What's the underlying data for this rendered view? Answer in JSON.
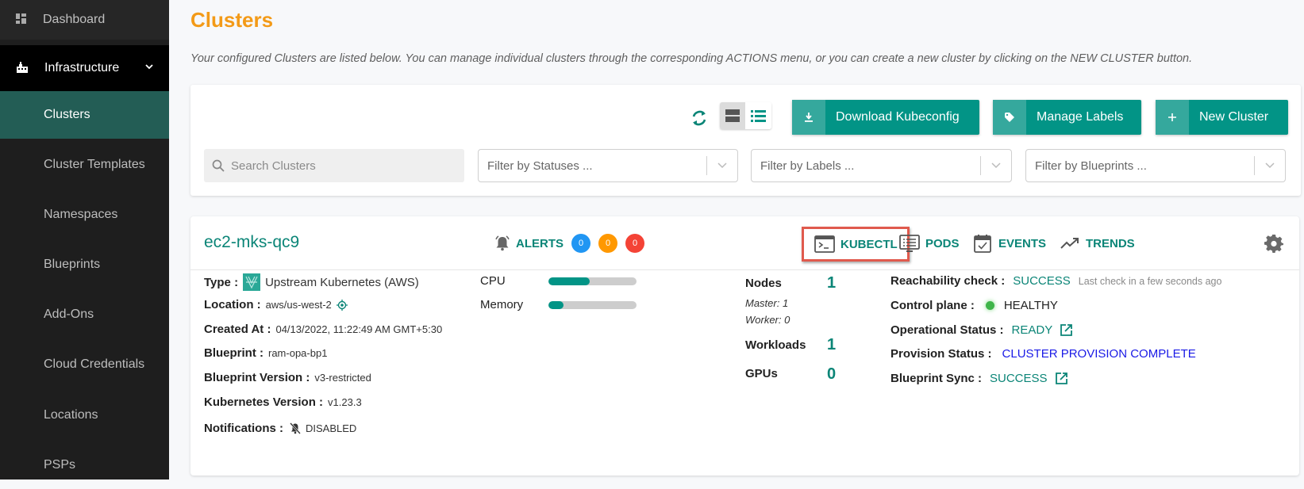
{
  "sidebar": {
    "dashboard": "Dashboard",
    "infrastructure": "Infrastructure",
    "items": [
      {
        "label": "Clusters",
        "active": true
      },
      {
        "label": "Cluster Templates"
      },
      {
        "label": "Namespaces"
      },
      {
        "label": "Blueprints"
      },
      {
        "label": "Add-Ons"
      },
      {
        "label": "Cloud Credentials"
      },
      {
        "label": "Locations"
      },
      {
        "label": "PSPs"
      }
    ]
  },
  "page": {
    "title": "Clusters",
    "description": "Your configured Clusters are listed below. You can manage individual clusters through the corresponding ACTIONS menu, or you can create a new cluster by clicking on the NEW CLUSTER button."
  },
  "toolbar": {
    "download_label": "Download Kubeconfig",
    "manage_labels_label": "Manage Labels",
    "new_cluster_label": "New Cluster",
    "search_placeholder": "Search Clusters",
    "filter_statuses": "Filter by Statuses ...",
    "filter_labels": "Filter by Labels ...",
    "filter_blueprints": "Filter by Blueprints ..."
  },
  "cluster": {
    "name": "ec2-mks-qc9",
    "alerts_label": "ALERTS",
    "alerts": [
      {
        "count": "0",
        "color": "#2196f3"
      },
      {
        "count": "0",
        "color": "#ff9800"
      },
      {
        "count": "0",
        "color": "#f44336"
      }
    ],
    "actions": {
      "kubectl": "KUBECTL",
      "pods": "PODS",
      "events": "EVENTS",
      "trends": "TRENDS"
    },
    "details": {
      "type_label": "Type :",
      "type_value": "Upstream Kubernetes (AWS)",
      "location_label": "Location :",
      "location_value": "aws/us-west-2",
      "created_label": "Created At :",
      "created_value": "04/13/2022, 11:22:49 AM GMT+5:30",
      "blueprint_label": "Blueprint :",
      "blueprint_value": "ram-opa-bp1",
      "bp_version_label": "Blueprint Version :",
      "bp_version_value": "v3-restricted",
      "k8s_version_label": "Kubernetes Version :",
      "k8s_version_value": "v1.23.3",
      "notifications_label": "Notifications :",
      "notifications_value": "DISABLED"
    },
    "resources": {
      "cpu_label": "CPU",
      "cpu_usage": 0.47,
      "memory_label": "Memory",
      "memory_usage": 0.17
    },
    "stats": {
      "nodes_label": "Nodes",
      "nodes_value": "1",
      "master": "Master: 1",
      "worker": "Worker: 0",
      "workloads_label": "Workloads",
      "workloads_value": "1",
      "gpus_label": "GPUs",
      "gpus_value": "0"
    },
    "status": {
      "reachability_label": "Reachability check :",
      "reachability_value": "SUCCESS",
      "reachability_note": "Last check in a few seconds ago",
      "control_plane_label": "Control plane :",
      "control_plane_value": "HEALTHY",
      "operational_label": "Operational Status :",
      "operational_value": "READY",
      "provision_label": "Provision Status :",
      "provision_value": "CLUSTER PROVISION COMPLETE",
      "bp_sync_label": "Blueprint Sync :",
      "bp_sync_value": "SUCCESS"
    }
  },
  "colors": {
    "accent_teal": "#029486",
    "title_orange": "#f39a17",
    "highlight_red": "#e05a4d",
    "provision_blue": "#1a1ae6"
  }
}
